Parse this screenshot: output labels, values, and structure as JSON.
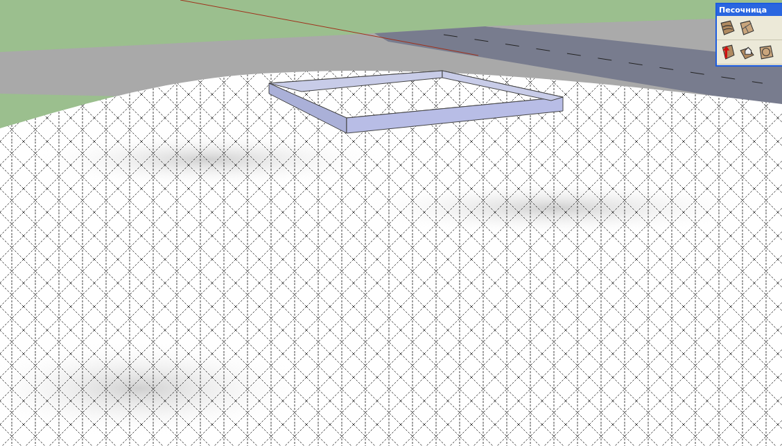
{
  "toolbar": {
    "title": "Песочница"
  }
}
